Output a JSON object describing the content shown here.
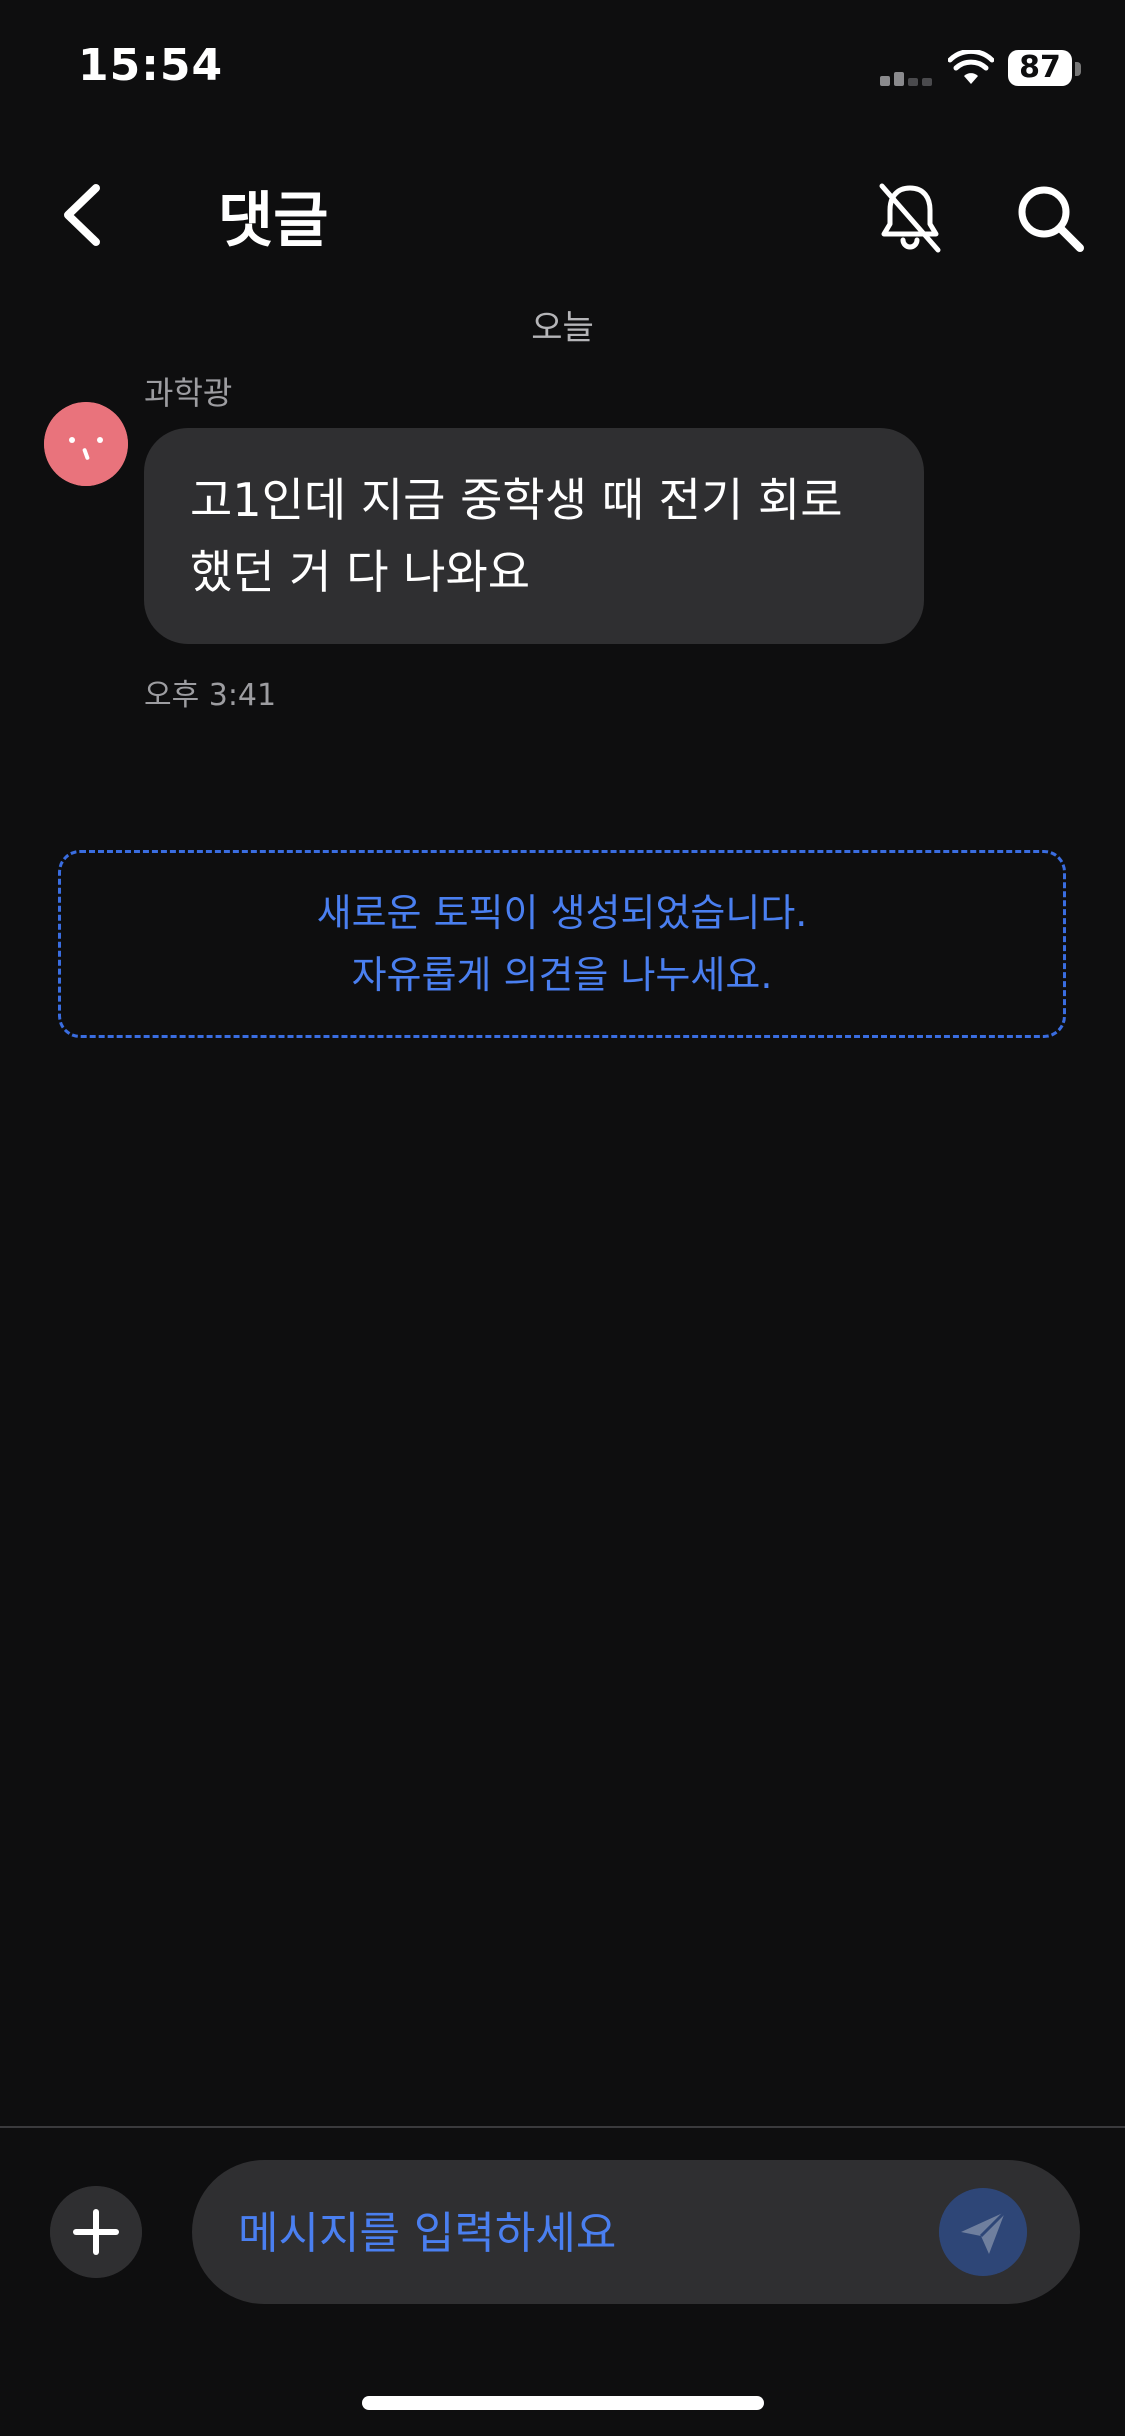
{
  "status_bar": {
    "time": "15:54",
    "battery": "87",
    "icons": [
      "cellular-signal-icon",
      "wifi-icon",
      "battery-icon"
    ]
  },
  "header": {
    "title": "댓글",
    "icons": [
      "chevron-left-icon",
      "bell-off-icon",
      "search-icon"
    ]
  },
  "chat": {
    "date_separator": "오늘",
    "messages": [
      {
        "sender": "과학광",
        "text": "고1인데 지금 중학생 때 전기 회로\n했던 거 다 나와요",
        "time": "오후 3:41"
      }
    ]
  },
  "notice": {
    "line1": "새로운 토픽이 생성되었습니다.",
    "line2": "자유롭게 의견을 나누세요."
  },
  "composer": {
    "placeholder": "메시지를 입력하세요",
    "value": "",
    "icons": [
      "plus-icon",
      "send-icon"
    ]
  },
  "colors": {
    "background": "#0e0e0f",
    "bubble": "#2f2f31",
    "accent_blue": "#4a7ff0",
    "avatar": "#e9737c",
    "send_button": "#2e4677"
  }
}
